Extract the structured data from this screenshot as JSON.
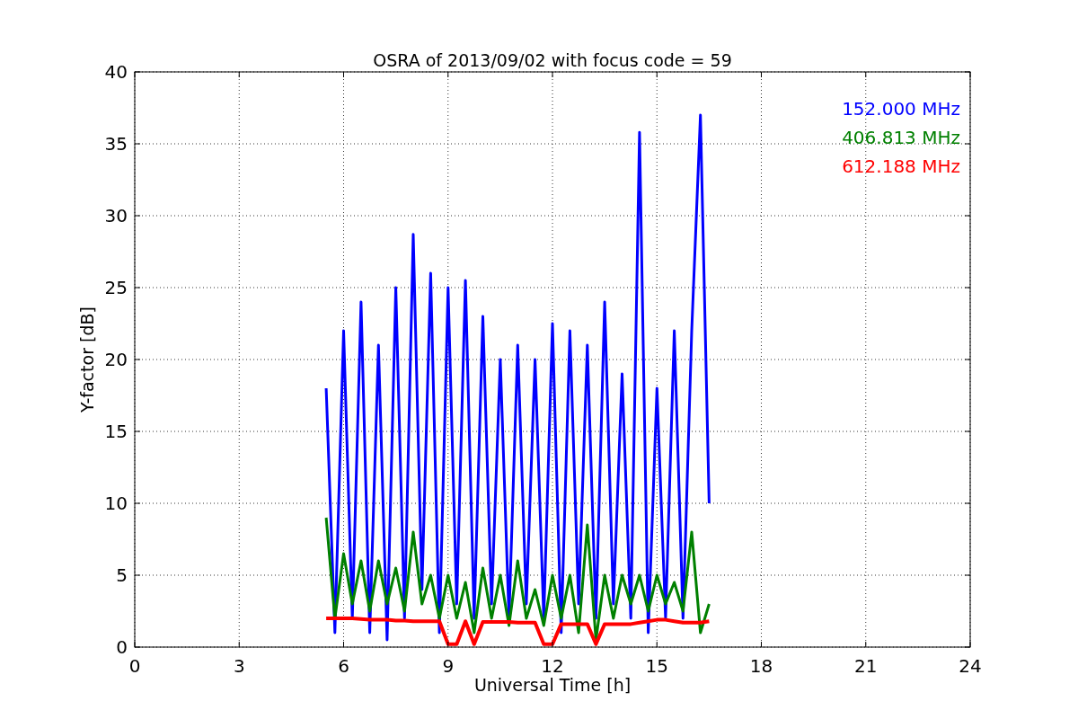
{
  "figure": {
    "chart_data": {
      "type": "line",
      "title": "OSRA of 2013/09/02 with focus code = 59",
      "xlabel": "Universal Time [h]",
      "ylabel": "Y-factor [dB]",
      "x": [
        5.5,
        5.75,
        6,
        6.25,
        6.5,
        6.75,
        7,
        7.25,
        7.5,
        7.75,
        8,
        8.25,
        8.5,
        8.75,
        9,
        9.25,
        9.5,
        9.75,
        10,
        10.25,
        10.5,
        10.75,
        11,
        11.25,
        11.5,
        11.75,
        12,
        12.25,
        12.5,
        12.75,
        13,
        13.25,
        13.5,
        13.75,
        14,
        14.25,
        14.5,
        14.75,
        15,
        15.25,
        15.5,
        15.75,
        16,
        16.25,
        16.5
      ],
      "series": [
        {
          "name": "152.000 MHz",
          "color": "#0000ff",
          "values": [
            18,
            1,
            22,
            2,
            24,
            1,
            21,
            0.5,
            25,
            2,
            28.7,
            4,
            26,
            1,
            25,
            3,
            25.5,
            2,
            23,
            3,
            20,
            2,
            21,
            3,
            20,
            2,
            22.5,
            1,
            22,
            3,
            21,
            2,
            24,
            3,
            19,
            2,
            35.8,
            1,
            18,
            2,
            22,
            2,
            22,
            37,
            10
          ]
        },
        {
          "name": "406.813 MHz",
          "color": "#008000",
          "values": [
            9,
            2,
            6.5,
            3,
            6,
            2.5,
            6,
            3,
            5.5,
            2.5,
            8,
            3,
            5,
            2,
            5,
            2,
            4.5,
            1,
            5.5,
            2,
            5,
            1.5,
            6,
            2,
            4,
            1.5,
            5,
            2,
            5,
            1,
            8.5,
            0.5,
            5,
            2,
            5,
            3,
            5,
            2.5,
            5,
            3,
            4.5,
            2.5,
            8,
            1,
            3
          ]
        },
        {
          "name": "612.188 MHz",
          "color": "#ff0000",
          "values": [
            2,
            2,
            2,
            2,
            1.95,
            1.9,
            1.9,
            1.9,
            1.85,
            1.85,
            1.8,
            1.8,
            1.8,
            1.8,
            0.2,
            0.2,
            1.8,
            0.2,
            1.75,
            1.75,
            1.75,
            1.75,
            1.7,
            1.7,
            1.7,
            0.2,
            0.2,
            1.6,
            1.6,
            1.6,
            1.6,
            0.2,
            1.6,
            1.6,
            1.6,
            1.6,
            1.7,
            1.8,
            1.9,
            1.9,
            1.8,
            1.7,
            1.7,
            1.7,
            1.8
          ]
        }
      ],
      "xlim": [
        0,
        24
      ],
      "ylim": [
        0,
        40
      ],
      "xticks": [
        0,
        3,
        6,
        9,
        12,
        15,
        18,
        21,
        24
      ],
      "yticks": [
        0,
        5,
        10,
        15,
        20,
        25,
        30,
        35,
        40
      ],
      "grid": true
    }
  }
}
